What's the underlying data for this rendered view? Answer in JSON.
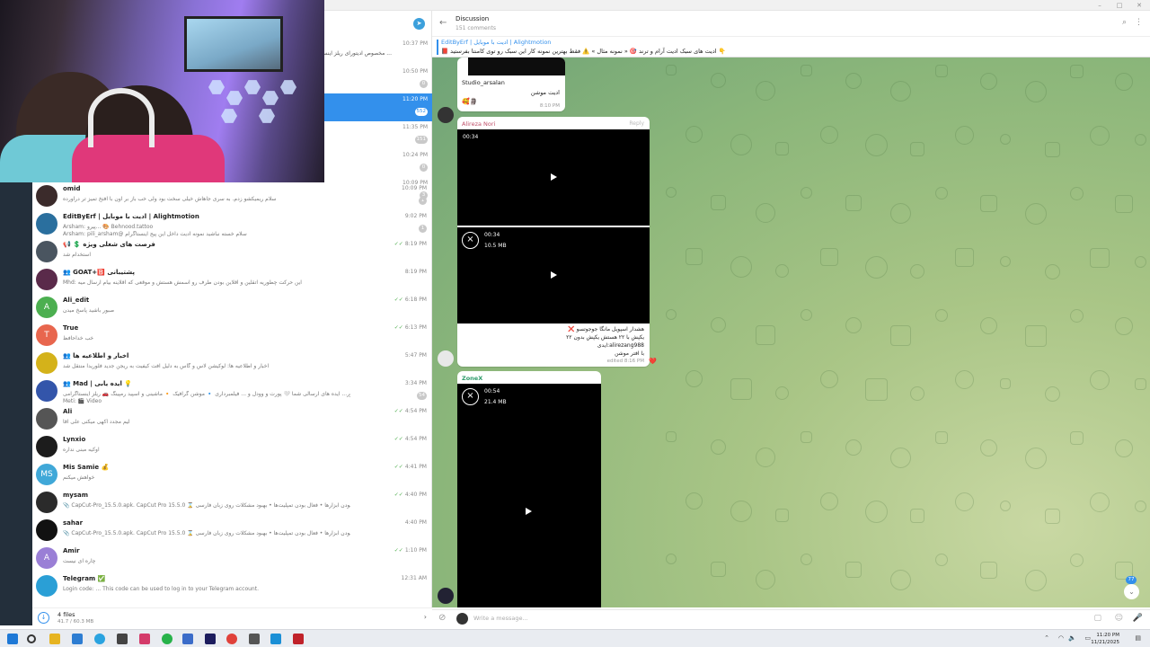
{
  "window": {
    "minimize": "–",
    "maximize": "□",
    "close": "✕"
  },
  "top_list": [
    {
      "time": "10:37 PM",
      "unread": "",
      "preview": "مخصوص ادیتورای ریلز اینستا ..."
    },
    {
      "time": "10:50 PM",
      "unread": "0",
      "preview": ""
    },
    {
      "time": "11:20 PM",
      "unread": "552",
      "preview": "",
      "selected": true
    },
    {
      "time": "11:35 PM",
      "unread": "151",
      "preview": ""
    },
    {
      "time": "10:24 PM",
      "unread": "0",
      "preview": ""
    },
    {
      "time": "10:09 PM",
      "unread": "3",
      "preview": ""
    }
  ],
  "chats": [
    {
      "name": "omid",
      "msg": "سلام ریمیکشو زدم. به سری جاهاش خیلی سخت بود ولی خب باز بر اون با افتخ تمیز تر درآورده",
      "time": "10:09 PM",
      "unread": "1",
      "avatar_color": "#3b2b2b",
      "avatar_letter": "",
      "ticks": false
    },
    {
      "name": "EditByErf | ادیت با موبایل | Alightmotion",
      "msg": "Arsham: پیرو... 🎨 Behnood.tattoo",
      "msg2": "Arsham: pili_arsham@ سلام خسته نباشید نمونه ادیت داخل این پیج اینستاگرام",
      "time": "9:02 PM",
      "unread": "1",
      "avatar_color": "#2a6f9e",
      "avatar_letter": "",
      "ticks": false
    },
    {
      "name": "📢 💲 فرصت های شغلی ویژه",
      "msg": "استخدام شد",
      "time": "8:19 PM",
      "unread": "",
      "avatar_color": "#4a5560",
      "avatar_letter": "",
      "ticks": true
    },
    {
      "name": "👥 GOAT+🅱️ پشتیبانی",
      "msg": "Mhd: این حرکت چطوریه اتقلین و اقلاین بودن طرف رو اسمش هستش و موقعی که اقلاینه بیام ارسال میه",
      "time": "8:19 PM",
      "unread": "",
      "avatar_color": "#5a2a4a",
      "avatar_letter": "",
      "ticks": false
    },
    {
      "name": "Ali_edit",
      "msg": "صبور باشید پاسخ میدن",
      "time": "6:18 PM",
      "unread": "",
      "avatar_color": "#4caf50",
      "avatar_letter": "A",
      "ticks": true
    },
    {
      "name": "True",
      "msg": "خب خداحافظ",
      "time": "6:13 PM",
      "unread": "",
      "avatar_color": "#e8664e",
      "avatar_letter": "T",
      "ticks": true
    },
    {
      "name": "👥 اخبار و اطلاعیه ها",
      "msg": "اخبار و اطلاعیه ها: لوکیشن لاس و گاس به دلیل افت کیفیت به ریجن جدید فلوریدا منتقل شد",
      "time": "5:47 PM",
      "unread": "",
      "avatar_color": "#d4b21a",
      "avatar_letter": "",
      "ticks": false
    },
    {
      "name": "👥 Mad | ایده یابی 💡",
      "msg": "استور... ایده های ارسالی شما 🤍 پورت و وودل و ... فیلمبرداری 🔹 موشن گرافیک 🔸 ماشینی و اسپید رمپینگ 🚗 ریلز اینستاگرامی",
      "msg2": "Meti: 🎬 Video",
      "time": "3:34 PM",
      "unread": "54",
      "avatar_color": "#3355aa",
      "avatar_letter": "",
      "ticks": false
    },
    {
      "name": "Ali",
      "msg": "لیم مجدد اکهی میکنی علی اقا",
      "time": "4:54 PM",
      "unread": "",
      "avatar_color": "#555",
      "avatar_letter": "",
      "ticks": true
    },
    {
      "name": "Lynxio",
      "msg": "اوکیه مبنی نداره",
      "time": "4:54 PM",
      "unread": "",
      "avatar_color": "#1c1c1c",
      "avatar_letter": "",
      "ticks": true
    },
    {
      "name": "Mis Samie 💰",
      "msg": "خواهش میکنم",
      "time": "4:41 PM",
      "unread": "",
      "avatar_color": "#40a8d8",
      "avatar_letter": "MS",
      "ticks": true
    },
    {
      "name": "mysam",
      "msg": "📎 CapCut-Pro_15.5.0.apk. CapCut Pro 15.5.0 ⌛ مزایای این نسخه: • بهروز بودن ابزارها • فعال بودن تمپلیت‌ها • بهبود مشکلات روی زبان فارسی",
      "time": "4:40 PM",
      "unread": "",
      "avatar_color": "#2b2b2b",
      "avatar_letter": "",
      "ticks": true
    },
    {
      "name": "sahar",
      "msg": "📎 CapCut-Pro_15.5.0.apk. CapCut Pro 15.5.0 ⌛ مزایای این نسخه: • بهروز بودن ابزارها • فعال بودن تمپلیت‌ها • بهبود مشکلات روی زبان فارسی",
      "time": "4:40 PM",
      "unread": "",
      "avatar_color": "#111",
      "avatar_letter": "",
      "ticks": false
    },
    {
      "name": "Amir",
      "msg": "چاره ای نیست",
      "time": "1:10 PM",
      "unread": "",
      "avatar_color": "#9a7fd6",
      "avatar_letter": "A",
      "ticks": true
    },
    {
      "name": "Telegram ✅",
      "msg": "Login code: ... This code can be used to log in to your Telegram account.",
      "time": "12:31 AM",
      "unread": "",
      "avatar_color": "#2a9fd6",
      "avatar_letter": "",
      "ticks": false
    }
  ],
  "left_footer": {
    "files": "4 files",
    "size": "41.7 / 60.3 MB"
  },
  "header": {
    "title": "Discussion",
    "subtitle": "151 comments"
  },
  "pinned": {
    "title": "EditByErf | ادیت با موبایل | Alightmotion",
    "preview": "📕 ادیت های سبک ادیت آرام و ترند 🎯 « نمونه مثال » ⚠️ فقط بهترین نمونه کار این سبک رو توی کامنتا بفرستید 👇"
  },
  "messages": {
    "m1": {
      "sender": "Studio_arsalan",
      "text": "ادیت موشن",
      "time": "8:10 PM",
      "reactions": "🥰🗿"
    },
    "m2": {
      "sender": "Alireza Nori",
      "reply": "Reply",
      "video1_duration": "00:34",
      "video2_duration": "00:34",
      "video2_size": "10.5 MB",
      "line1": "❌ هشدار اسپویل مانگا جوجوتسو",
      "line2": "یکپش با ۲۲ هستش یکپش بدون ۲۲",
      "line3": "ایدی:alirezang988",
      "line4": "با افتر موشن",
      "time": "edited 8:16 PM",
      "reaction": "❤️"
    },
    "m3": {
      "sender": "ZoneX",
      "video_duration": "00:54",
      "video_size": "21.4 MB"
    }
  },
  "scroll_badge": "77",
  "composer": {
    "placeholder": "Write a message..."
  },
  "taskbar": {
    "time": "11:20 PM",
    "date": "11/21/2025"
  }
}
